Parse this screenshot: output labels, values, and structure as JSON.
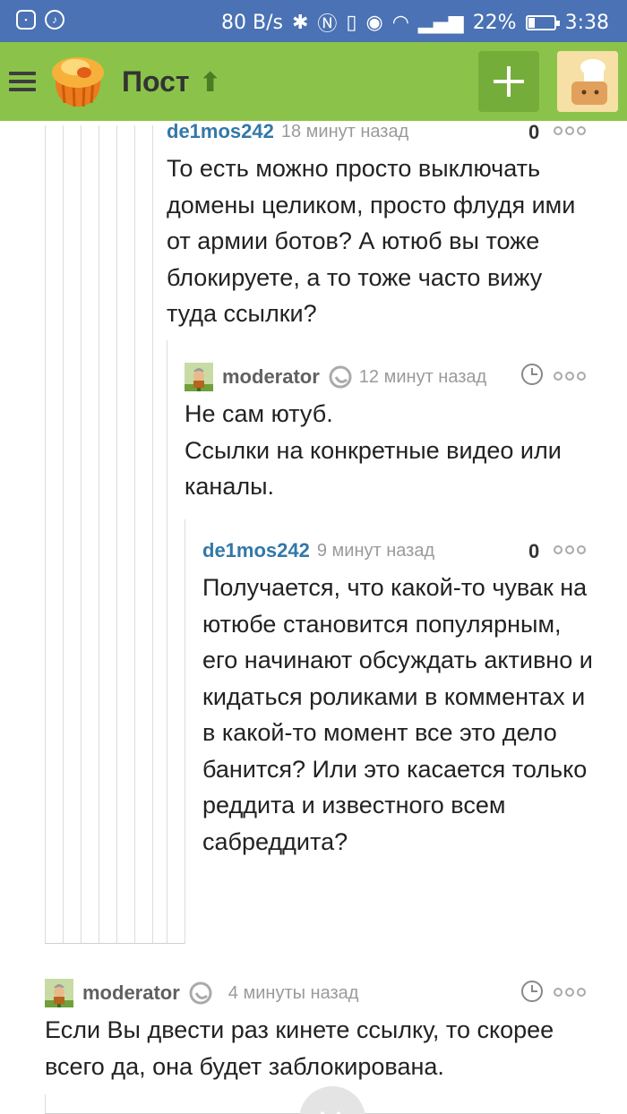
{
  "status_bar": {
    "speed": "80 B/s",
    "battery": "22%",
    "battery_level": 0.22,
    "time": "3:38"
  },
  "app_bar": {
    "title": "Пост",
    "menu_icon": "hamburger-icon",
    "add_icon": "plus-icon"
  },
  "comments": [
    {
      "user": "de1mos242",
      "time": "18 минут назад",
      "rating": "0",
      "text": "То есть можно просто выключать домены целиком, просто флудя ими от армии ботов? А ютюб вы тоже блокируете, а то тоже часто вижу туда ссылки?"
    },
    {
      "user": "moderator",
      "time": "12 минут назад",
      "text_line1": "Не сам ютуб.",
      "text_line2": "Ссылки на конкретные видео или каналы."
    },
    {
      "user": "de1mos242",
      "time": "9 минут назад",
      "rating": "0",
      "text": "Получается, что какой-то чувак на ютюбе становится популярным, его начинают обсуждать активно и кидаться роликами в комментах и в какой-то момент все это дело банится? Или это касается только реддита и известного всем сабреддита?"
    },
    {
      "user": "moderator",
      "time": "4 минуты назад",
      "text": "Если Вы двести раз кинете ссылку, то скорее всего да, она будет заблокирована."
    }
  ],
  "colors": {
    "status_bar": "#4a72b4",
    "app_bar": "#8bc34a",
    "username": "#3278a8"
  }
}
